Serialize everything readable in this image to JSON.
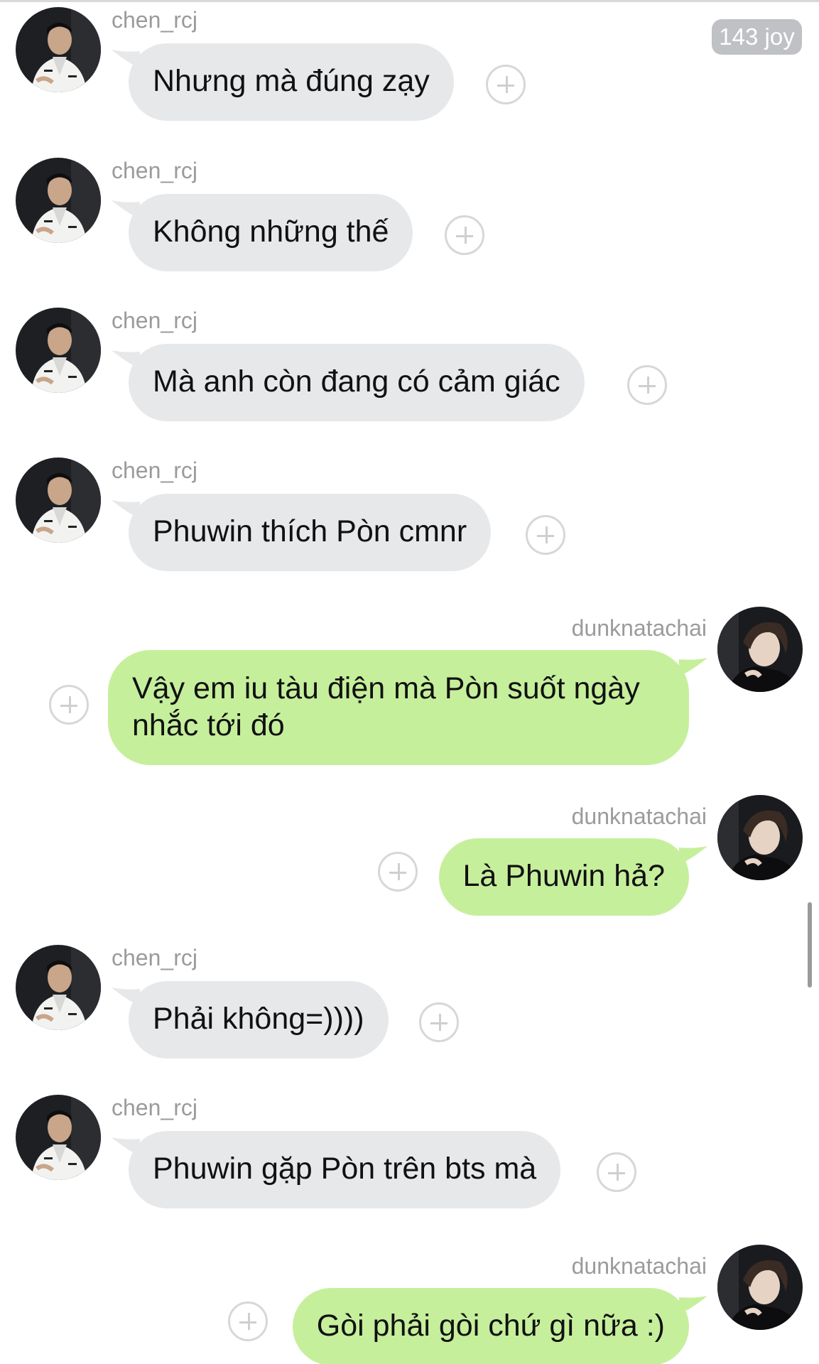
{
  "header": {
    "badge": "143 joy"
  },
  "colors": {
    "incoming_bubble": "#e7e8ea",
    "outgoing_bubble": "#c6ef9c",
    "sender_name": "#9b9b9b"
  },
  "messages": [
    {
      "sender": "chen_rcj",
      "direction": "incoming",
      "text": "Nhưng mà đúng zạy"
    },
    {
      "sender": "chen_rcj",
      "direction": "incoming",
      "text": "Không những thế"
    },
    {
      "sender": "chen_rcj",
      "direction": "incoming",
      "text": "Mà anh còn đang có cảm giác"
    },
    {
      "sender": "chen_rcj",
      "direction": "incoming",
      "text": "Phuwin thích Pòn cmnr"
    },
    {
      "sender": "dunknatachai",
      "direction": "outgoing",
      "text": "Vậy em iu tàu điện mà Pòn suốt ngày nhắc tới đó"
    },
    {
      "sender": "dunknatachai",
      "direction": "outgoing",
      "text": "Là Phuwin hả?"
    },
    {
      "sender": "chen_rcj",
      "direction": "incoming",
      "text": "Phải không=))))"
    },
    {
      "sender": "chen_rcj",
      "direction": "incoming",
      "text": "Phuwin gặp Pòn trên bts mà"
    },
    {
      "sender": "dunknatachai",
      "direction": "outgoing",
      "text": "Gòi phải gòi chứ gì nữa :)"
    }
  ],
  "icons": {
    "add_reaction": "plus-circle-icon",
    "avatar_incoming": "avatar-chen-rcj",
    "avatar_outgoing": "avatar-dunknatachai"
  }
}
